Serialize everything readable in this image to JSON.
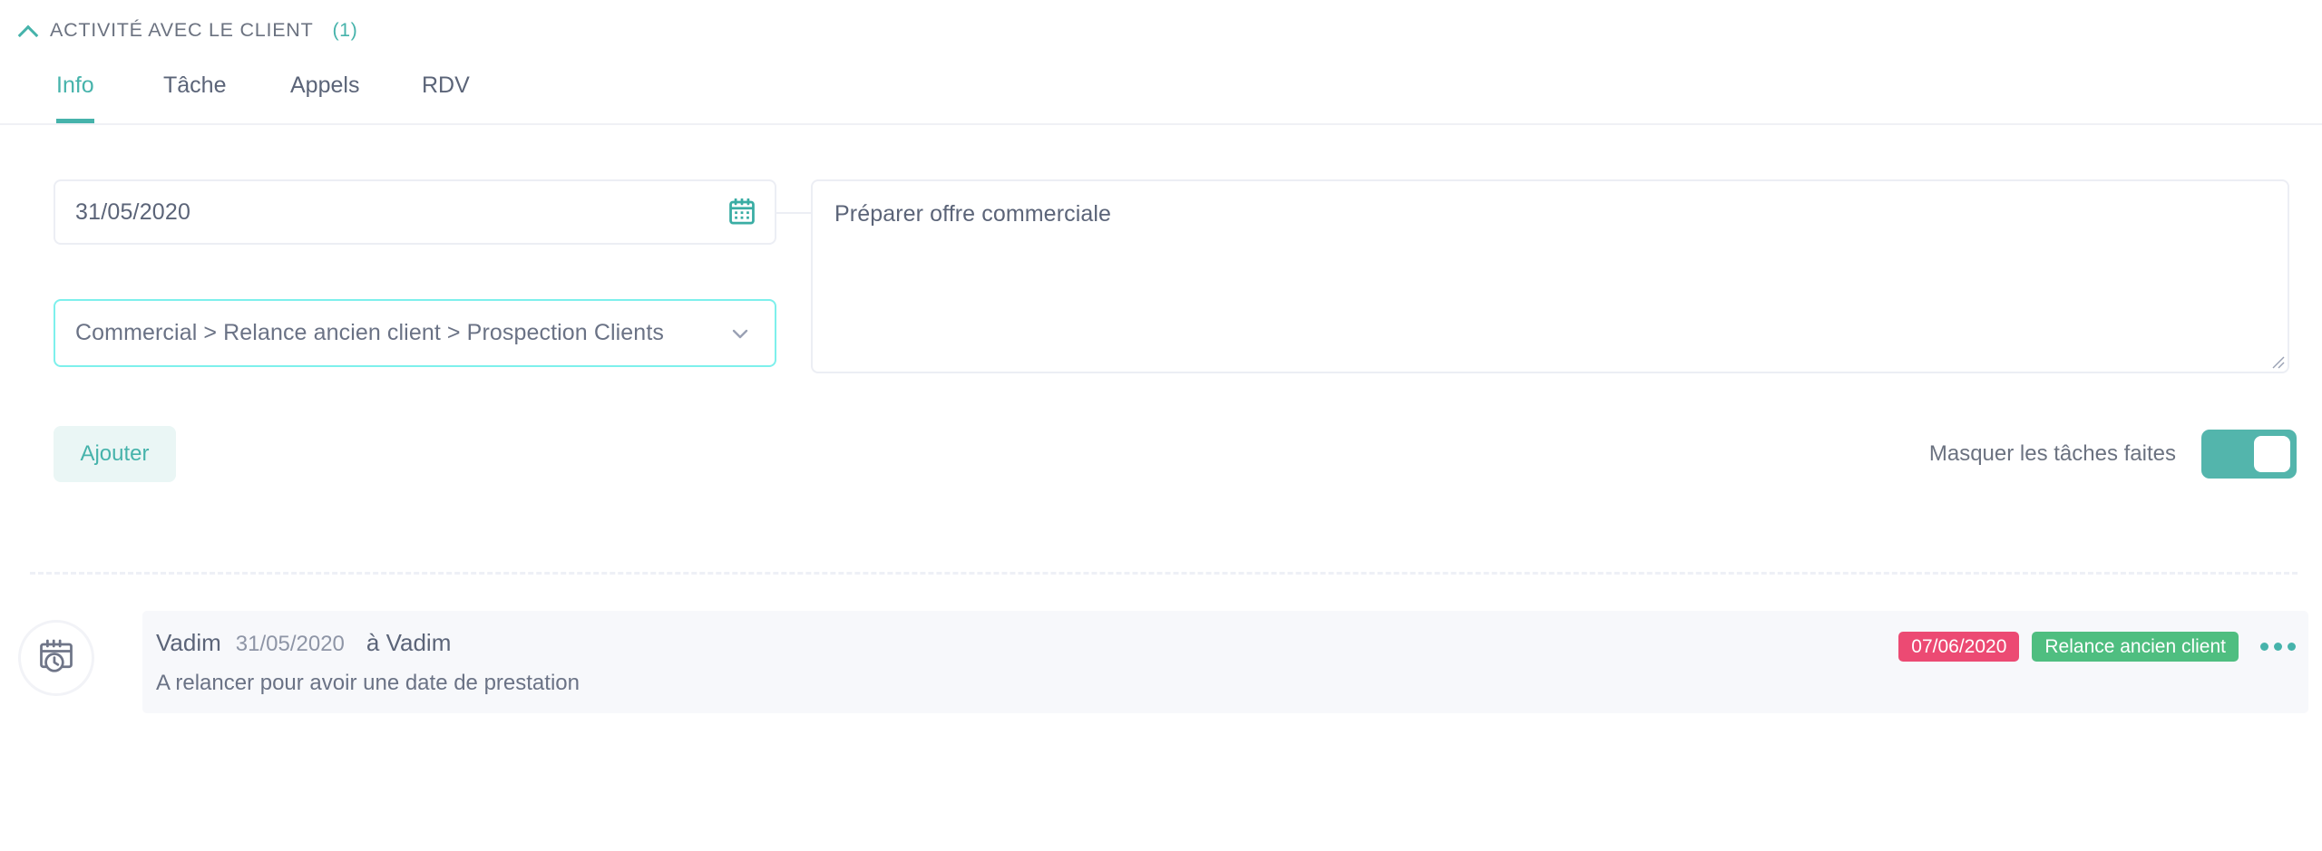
{
  "header": {
    "collapse_icon": "chevron-up-icon",
    "title": "ACTIVITÉ AVEC LE CLIENT",
    "count": "(1)"
  },
  "tabs": [
    {
      "label": "Info",
      "active": true
    },
    {
      "label": "Tâche",
      "active": false
    },
    {
      "label": "Appels",
      "active": false
    },
    {
      "label": "RDV",
      "active": false
    }
  ],
  "form": {
    "date": {
      "value": "31/05/2020",
      "icon": "calendar-icon"
    },
    "category": {
      "value": "Commercial > Relance ancien client > Prospection Clients",
      "icon": "chevron-down-icon"
    },
    "note": {
      "value": "Préparer offre commerciale"
    }
  },
  "actions": {
    "add_label": "Ajouter",
    "toggle_label": "Masquer les tâches faites",
    "toggle_state": "on"
  },
  "activity": {
    "icon": "calendar-clock-icon",
    "user": "Vadim",
    "date": "31/05/2020",
    "assignee": "à Vadim",
    "description": "A relancer pour avoir une date de prestation",
    "badge_date": "07/06/2020",
    "badge_tag": "Relance ancien client",
    "more_icon": "more-horizontal-icon"
  },
  "colors": {
    "accent": "#46b3ab",
    "toggle_on": "#53b5ac",
    "focus_border": "#7ef0ec",
    "badge_date_bg": "#ec4a73",
    "badge_tag_bg": "#4fbe80",
    "text": "#5b6478",
    "muted": "#8e95a6",
    "row_bg": "#f7f8fb",
    "field_border": "#eceef4"
  }
}
